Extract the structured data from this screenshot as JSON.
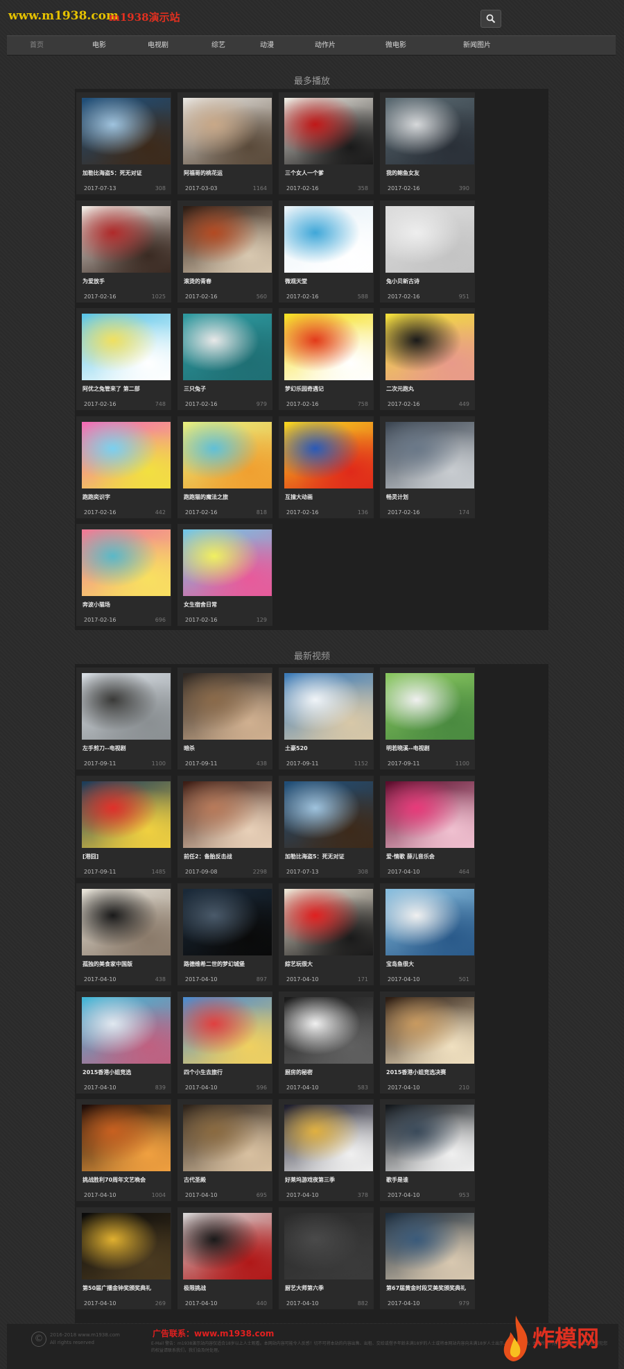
{
  "header": {
    "logo": "www.m1938.com",
    "logo_sub": "m1938演示站"
  },
  "nav": [
    {
      "label": "首页"
    },
    {
      "label": "电影"
    },
    {
      "label": "电视剧"
    },
    {
      "label": "综艺"
    },
    {
      "label": "动漫"
    },
    {
      "label": "动作片"
    },
    {
      "label": "微电影"
    },
    {
      "label": "新闻图片"
    }
  ],
  "sections": [
    {
      "title": "最多播放",
      "items": [
        {
          "title": "加勒比海盗5：死无对证",
          "date": "2017-07-13",
          "views": "308",
          "thumb": [
            "#1f4f7a",
            "#9fc3de",
            "#3d2a1a"
          ]
        },
        {
          "title": "阿福哥的桃花运",
          "date": "2017-03-03",
          "views": "1164",
          "thumb": [
            "#e9e6e1",
            "#c8a888",
            "#5a4a3a"
          ]
        },
        {
          "title": "三个女人一个爹",
          "date": "2017-02-16",
          "views": "358",
          "thumb": [
            "#f0ece4",
            "#c01818",
            "#1a1a1a"
          ]
        },
        {
          "title": "我的鲍鱼女友",
          "date": "2017-02-16",
          "views": "390",
          "thumb": [
            "#5a6a72",
            "#d6d8da",
            "#2a3038"
          ]
        },
        {
          "title": "为爱放手",
          "date": "2017-02-16",
          "views": "1025",
          "thumb": [
            "#f3ece6",
            "#b02a2a",
            "#3a2a22"
          ]
        },
        {
          "title": "滚烫的青春",
          "date": "2017-02-16",
          "views": "560",
          "thumb": [
            "#2a1a12",
            "#b34a22",
            "#d8c8b0"
          ]
        },
        {
          "title": "微观天堂",
          "date": "2017-02-16",
          "views": "588",
          "thumb": [
            "#e8f2f8",
            "#3fa7d8",
            "#ffffff"
          ]
        },
        {
          "title": "兔小贝新古诗",
          "date": "2017-02-16",
          "views": "951",
          "thumb": [
            "#dcdcdc",
            "#eeeeee",
            "#c4c4c4"
          ]
        },
        {
          "title": "阿优之兔管来了 第二部",
          "date": "2017-02-16",
          "views": "748",
          "thumb": [
            "#58c4e8",
            "#f0e060",
            "#ffffff"
          ]
        },
        {
          "title": "三只兔子",
          "date": "2017-02-16",
          "views": "979",
          "thumb": [
            "#2e9aa0",
            "#e8e8e8",
            "#1f6f74"
          ]
        },
        {
          "title": "梦幻乐园奇遇记",
          "date": "2017-02-16",
          "views": "758",
          "thumb": [
            "#f6e020",
            "#e23a1a",
            "#ffffff"
          ]
        },
        {
          "title": "二次元跑丸",
          "date": "2017-02-16",
          "views": "449",
          "thumb": [
            "#f2e03a",
            "#1a1a1a",
            "#e89a8a"
          ]
        },
        {
          "title": "跑跑奕识字",
          "date": "2017-02-16",
          "views": "442",
          "thumb": [
            "#f46ab8",
            "#7ad0f0",
            "#f2e040"
          ]
        },
        {
          "title": "跑跑猫的魔法之旅",
          "date": "2017-02-16",
          "views": "818",
          "thumb": [
            "#e8f080",
            "#60c0d8",
            "#f0a030"
          ]
        },
        {
          "title": "互撞大动画",
          "date": "2017-02-16",
          "views": "136",
          "thumb": [
            "#f8d820",
            "#2a5ab8",
            "#e02a1a"
          ]
        },
        {
          "title": "畅灵计划",
          "date": "2017-02-16",
          "views": "174",
          "thumb": [
            "#3a4450",
            "#6a7888",
            "#c8ccd0"
          ]
        },
        {
          "title": "奔波小猫场",
          "date": "2017-02-16",
          "views": "696",
          "thumb": [
            "#f07898",
            "#5ab8c8",
            "#f8e060"
          ]
        },
        {
          "title": "女生宿舍日常",
          "date": "2017-02-16",
          "views": "129",
          "thumb": [
            "#70c8e8",
            "#f0f060",
            "#e85a9a"
          ]
        }
      ]
    },
    {
      "title": "最新视频",
      "items": [
        {
          "title": "左手剪刀--电视剧",
          "date": "2017-09-11",
          "views": "1100",
          "thumb": [
            "#d8dee4",
            "#3a3a38",
            "#8a8f92"
          ]
        },
        {
          "title": "暗杀",
          "date": "2017-09-11",
          "views": "438",
          "thumb": [
            "#2a2420",
            "#8a6a4a",
            "#d0b090"
          ]
        },
        {
          "title": "土豪520",
          "date": "2017-09-11",
          "views": "1152",
          "thumb": [
            "#3a7ab8",
            "#f0f4f8",
            "#d8c8a8"
          ]
        },
        {
          "title": "明若晓溪--电视剧",
          "date": "2017-09-11",
          "views": "1100",
          "thumb": [
            "#8ac860",
            "#f0f0f0",
            "#4a8a40"
          ]
        },
        {
          "title": "[港囧]",
          "date": "2017-09-11",
          "views": "1485",
          "thumb": [
            "#1a3a5a",
            "#e0302a",
            "#f0d040"
          ]
        },
        {
          "title": "前任2：备胎反击战",
          "date": "2017-09-08",
          "views": "2298",
          "thumb": [
            "#3a1a12",
            "#b87a5a",
            "#e8d0b8"
          ]
        },
        {
          "title": "加勒比海盗5：死无对证",
          "date": "2017-07-13",
          "views": "308",
          "thumb": [
            "#1f4f7a",
            "#9fc3de",
            "#3d2a1a"
          ]
        },
        {
          "title": "爱·情歌 薛儿音乐会",
          "date": "2017-04-10",
          "views": "464",
          "thumb": [
            "#5a0a2a",
            "#e83a7a",
            "#f0c0d0"
          ]
        },
        {
          "title": "孤独的美食家中国版",
          "date": "2017-04-10",
          "views": "438",
          "thumb": [
            "#e8e4da",
            "#1a1a1a",
            "#8a7a6a"
          ]
        },
        {
          "title": "路德维希二世的梦幻城堡",
          "date": "2017-04-10",
          "views": "897",
          "thumb": [
            "#1a2a3a",
            "#4a5a6a",
            "#0a0a0a"
          ]
        },
        {
          "title": "綜艺玩很大",
          "date": "2017-04-10",
          "views": "171",
          "thumb": [
            "#f0e8d8",
            "#e02020",
            "#1a1a1a"
          ]
        },
        {
          "title": "宝岛鱼很大",
          "date": "2017-04-10",
          "views": "501",
          "thumb": [
            "#8ac0e0",
            "#f0f0f0",
            "#2a5a8a"
          ]
        },
        {
          "title": "2015香港小姐竞选",
          "date": "2017-04-10",
          "views": "839",
          "thumb": [
            "#40b8d8",
            "#e0e8f0",
            "#c06080"
          ]
        },
        {
          "title": "四个小生去旅行",
          "date": "2017-04-10",
          "views": "596",
          "thumb": [
            "#4a8ad0",
            "#e04040",
            "#f0d060"
          ]
        },
        {
          "title": "厨房的秘密",
          "date": "2017-04-10",
          "views": "583",
          "thumb": [
            "#1a1a1a",
            "#f0f0f0",
            "#606060"
          ]
        },
        {
          "title": "2015香港小姐竞选决赛",
          "date": "2017-04-10",
          "views": "210",
          "thumb": [
            "#2a1a10",
            "#c89a60",
            "#f0e0c0"
          ]
        },
        {
          "title": "挑战胜利70周年文艺晚会",
          "date": "2017-04-10",
          "views": "1004",
          "thumb": [
            "#1a0a08",
            "#c86020",
            "#f0a040"
          ]
        },
        {
          "title": "古代圣殿",
          "date": "2017-04-10",
          "views": "695",
          "thumb": [
            "#2a2018",
            "#8a6a40",
            "#d8c0a0"
          ]
        },
        {
          "title": "好莱坞游戏夜第三季",
          "date": "2017-04-10",
          "views": "378",
          "thumb": [
            "#1a1a2a",
            "#e0b040",
            "#f0f0f0"
          ]
        },
        {
          "title": "歌手是谁",
          "date": "2017-04-10",
          "views": "953",
          "thumb": [
            "#101418",
            "#3a4a5a",
            "#f0f0f0"
          ]
        },
        {
          "title": "第50届广播金钟奖颁奖典礼",
          "date": "2017-04-10",
          "views": "269",
          "thumb": [
            "#0a0a0a",
            "#e0b030",
            "#4a3a20"
          ]
        },
        {
          "title": "极限挑战",
          "date": "2017-04-10",
          "views": "440",
          "thumb": [
            "#d8d8d8",
            "#1a1a1a",
            "#b01818"
          ]
        },
        {
          "title": "厨艺大师第六季",
          "date": "2017-04-10",
          "views": "882",
          "thumb": [
            "#2a2a2a",
            "#4a4a4a",
            "#3a3a3a"
          ]
        },
        {
          "title": "第67届黄金时段艾美奖颁奖典礼",
          "date": "2017-04-10",
          "views": "979",
          "thumb": [
            "#1a2a3a",
            "#3a5a7a",
            "#d8c8b0"
          ]
        }
      ]
    }
  ],
  "footer": {
    "copy_symbol": "©",
    "copyright_line1": "2016-2018 www.m1938.com",
    "copyright_line2": "All rights reserved",
    "ad_text": "广告联系：www.m1938.com",
    "disclaimer": "E-Mail 警告：m1938演示站内容仅适合18岁以上人士观看。本网站内容可能令人反感！切不可将本站的内容出售、出租、交给或借予年龄未满18岁的人士或将本网站内容向未满18岁人士出示、播放或放映。本站所有内容由用户上传，如发现侵犯您的权益请联系我们，我们会及时处理。"
  },
  "watermark": {
    "text": "炸模网"
  },
  "colors": {
    "logo": "#e6c200",
    "logo_sub": "#e03020",
    "ad": "#e02020",
    "watermark": "#e03020"
  }
}
